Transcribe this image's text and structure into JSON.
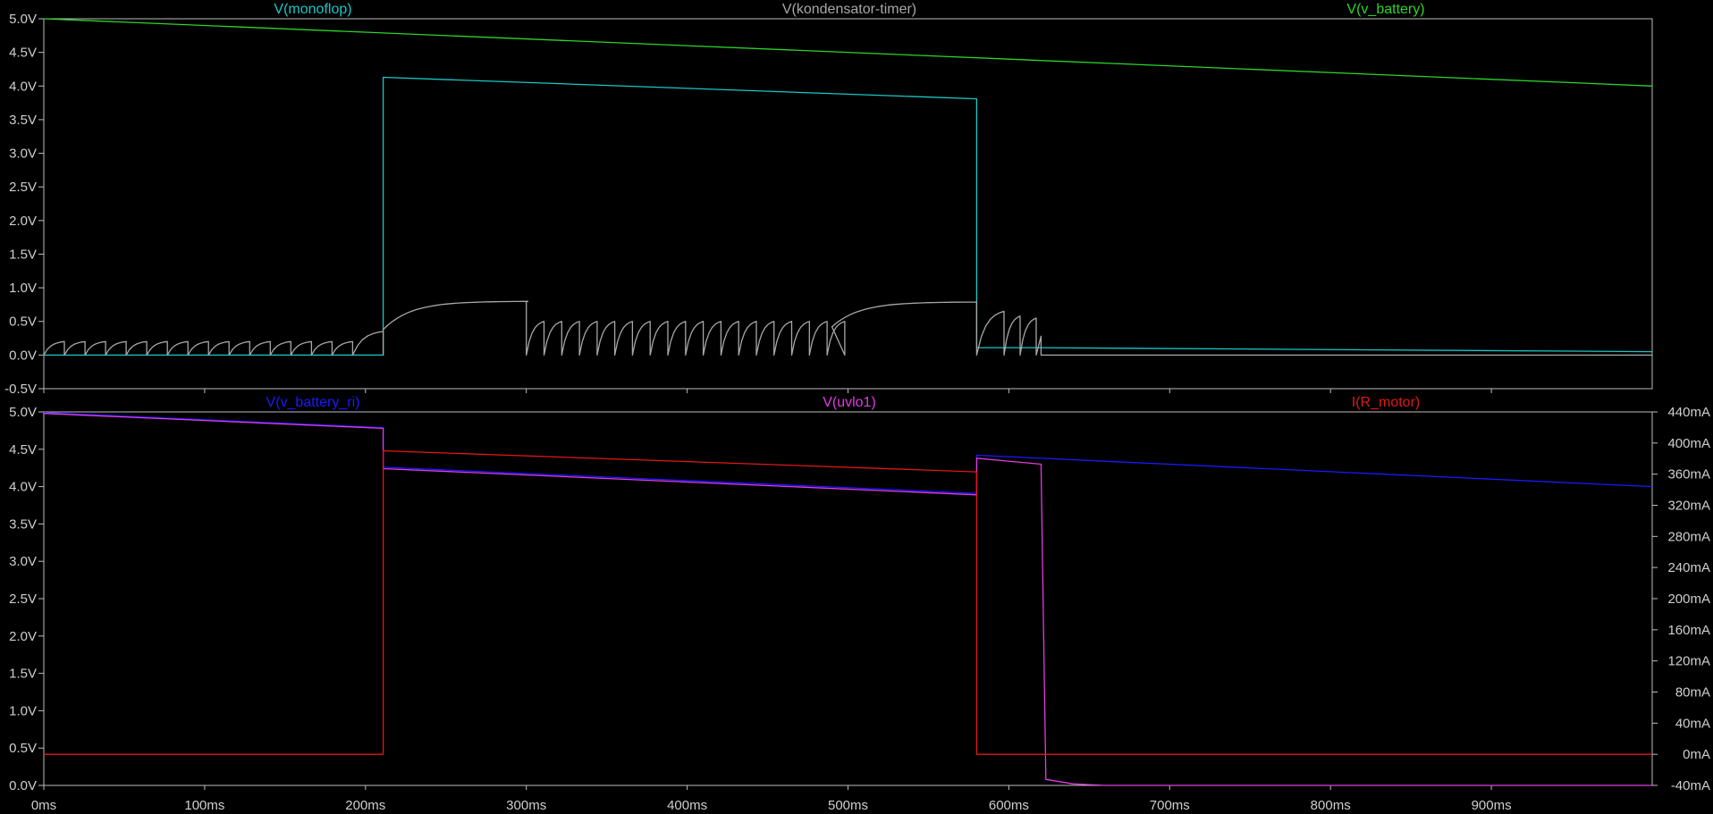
{
  "chart_data": [
    {
      "type": "line",
      "xaxis": {
        "ticks": [
          "0ms",
          "100ms",
          "200ms",
          "300ms",
          "400ms",
          "500ms",
          "600ms",
          "700ms",
          "800ms",
          "900ms"
        ],
        "range_ms": [
          0,
          1000
        ]
      },
      "yaxis": {
        "ticks": [
          "5.0V",
          "4.5V",
          "4.0V",
          "3.5V",
          "3.0V",
          "2.5V",
          "2.0V",
          "1.5V",
          "1.0V",
          "0.5V",
          "0.0V",
          "-0.5V"
        ],
        "range": [
          -0.5,
          5.0
        ]
      },
      "series": [
        {
          "name": "V(monoflop)",
          "color": "#19c7c7",
          "points": [
            [
              0,
              0
            ],
            [
              211,
              0
            ],
            [
              211,
              4.13
            ],
            [
              580,
              3.81
            ],
            [
              580,
              0.11
            ],
            [
              620,
              0.11
            ],
            [
              1000,
              0.05
            ]
          ]
        },
        {
          "name": "V(kondensator-timer)",
          "color": "#a8a8a8",
          "points": [
            [
              0,
              0.0
            ],
            [
              211,
              0.47
            ],
            [
              220,
              0.58
            ],
            [
              300,
              0.8
            ],
            [
              300,
              0.0
            ],
            [
              490,
              0.52
            ],
            [
              500,
              0.6
            ],
            [
              580,
              0.79
            ],
            [
              580,
              0.0
            ],
            [
              620,
              0.1
            ],
            [
              625,
              0.0
            ],
            [
              1000,
              0.0
            ]
          ]
        },
        {
          "name": "V(v_battery)",
          "color": "#2bd52b",
          "points": [
            [
              0,
              5.0
            ],
            [
              1000,
              4.0
            ]
          ]
        }
      ]
    },
    {
      "type": "line",
      "xaxis": {
        "ticks": [
          "0ms",
          "100ms",
          "200ms",
          "300ms",
          "400ms",
          "500ms",
          "600ms",
          "700ms",
          "800ms",
          "900ms"
        ],
        "range_ms": [
          0,
          1000
        ]
      },
      "yaxis": {
        "ticks": [
          "5.0V",
          "4.5V",
          "4.0V",
          "3.5V",
          "3.0V",
          "2.5V",
          "2.0V",
          "1.5V",
          "1.0V",
          "0.5V",
          "0.0V"
        ],
        "range": [
          0.0,
          5.0
        ]
      },
      "y2axis": {
        "ticks": [
          "440mA",
          "400mA",
          "360mA",
          "320mA",
          "280mA",
          "240mA",
          "200mA",
          "160mA",
          "120mA",
          "80mA",
          "40mA",
          "0mA",
          "-40mA"
        ],
        "range_mA": [
          -40,
          440
        ]
      },
      "series": [
        {
          "name": "V(v_battery_ri)",
          "color": "#1a1aff",
          "points": [
            [
              0,
              4.99
            ],
            [
              211,
              4.79
            ],
            [
              211,
              4.26
            ],
            [
              580,
              3.91
            ],
            [
              580,
              4.42
            ],
            [
              1000,
              4.0
            ]
          ]
        },
        {
          "name": "V(uvlo1)",
          "color": "#e03ce0",
          "points": [
            [
              0,
              4.98
            ],
            [
              211,
              4.78
            ],
            [
              211,
              4.24
            ],
            [
              580,
              3.89
            ],
            [
              580,
              4.38
            ],
            [
              620,
              4.3
            ],
            [
              623,
              0.08
            ],
            [
              640,
              0.02
            ],
            [
              660,
              0.0
            ],
            [
              1000,
              0.0
            ]
          ]
        },
        {
          "name": "I(R_motor)",
          "unit": "mA",
          "color": "#e01818",
          "points": [
            [
              0,
              0
            ],
            [
              211,
              0
            ],
            [
              211,
              390
            ],
            [
              580,
              363
            ],
            [
              580,
              0
            ],
            [
              1000,
              0
            ]
          ]
        }
      ]
    }
  ]
}
